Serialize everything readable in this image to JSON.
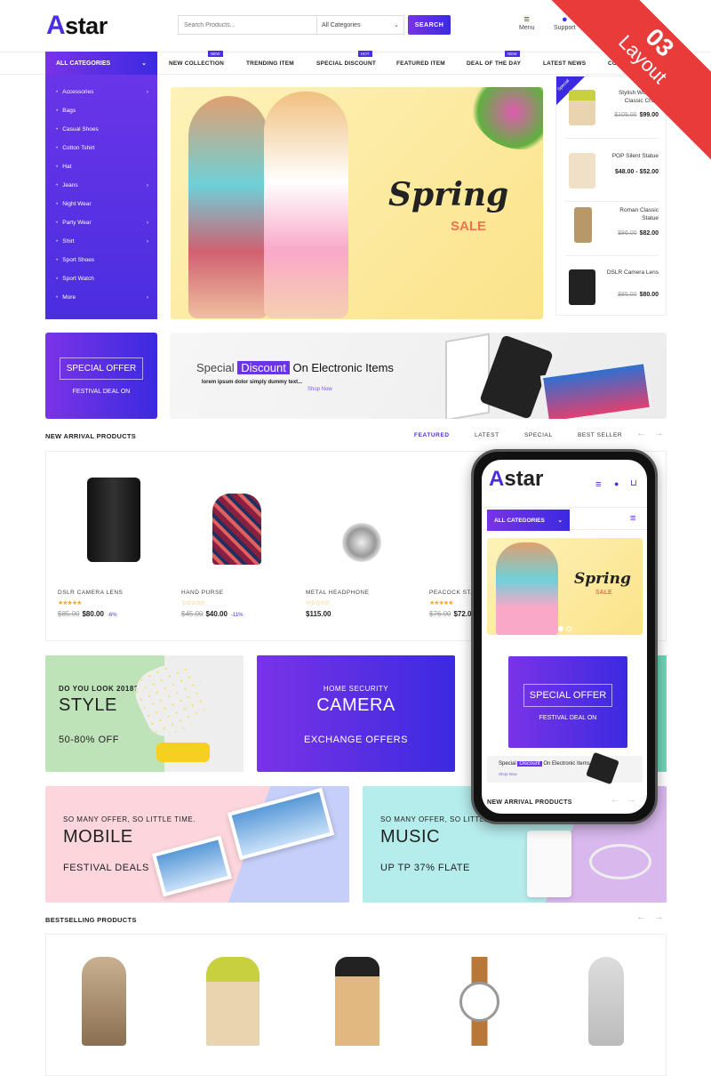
{
  "header": {
    "logo": "star",
    "logo_mark": "A",
    "search_placeholder": "Search Products...",
    "category_select": "All Categories",
    "search_button": "SEARCH",
    "menu_label": "Menu",
    "support_label": "Support"
  },
  "ribbon": {
    "number": "03",
    "label": "Layout"
  },
  "nav": {
    "all_categories": "ALL CATEGORIES",
    "items": [
      {
        "label": "NEW COLLECTION",
        "badge": "NEW"
      },
      {
        "label": "TRENDING ITEM"
      },
      {
        "label": "SPECIAL DISCOUNT",
        "badge": "HOT"
      },
      {
        "label": "FEATURED ITEM"
      },
      {
        "label": "DEAL OF THE DAY",
        "badge": "NEW"
      },
      {
        "label": "LATEST NEWS"
      },
      {
        "label": "CO"
      }
    ]
  },
  "sidebar": {
    "items": [
      {
        "label": "Accessories",
        "sub": true
      },
      {
        "label": "Bags"
      },
      {
        "label": "Casual Shoes"
      },
      {
        "label": "Cotton Tshirt"
      },
      {
        "label": "Hat"
      },
      {
        "label": "Jeans",
        "sub": true
      },
      {
        "label": "Night Wear"
      },
      {
        "label": "Party Wear",
        "sub": true
      },
      {
        "label": "Shirt",
        "sub": true
      },
      {
        "label": "Sport Shoes"
      },
      {
        "label": "Sport Watch"
      },
      {
        "label": "More",
        "sub": true
      }
    ]
  },
  "hero": {
    "title": "Spring",
    "subtitle": "SALE"
  },
  "special_products": {
    "tag": "Special",
    "items": [
      {
        "name": "Stylish Wooden Classic Chair",
        "old_price": "$105.00",
        "price": "$99.00"
      },
      {
        "name": "POP Silent Statue",
        "old_price": "",
        "price": "$48.00 - $52.00"
      },
      {
        "name": "Roman Classic Statue",
        "old_price": "$86.00",
        "price": "$82.00"
      },
      {
        "name": "DSLR Camera Lens",
        "old_price": "$85.00",
        "price": "$80.00"
      }
    ]
  },
  "offer": {
    "title": "SPECIAL OFFER",
    "subtitle": "FESTIVAL DEAL ON"
  },
  "discount_banner": {
    "word1": "Special",
    "highlight": "Discount",
    "rest": "On Electronic Items",
    "desc": "lorem ipsum dolor simply dummy text...",
    "link": "Shop Now"
  },
  "new_arrival": {
    "title": "NEW ARRIVAL PRODUCTS",
    "tabs": [
      "FEATURED",
      "LATEST",
      "SPECIAL",
      "BEST SELLER"
    ],
    "active_tab": "FEATURED",
    "products": [
      {
        "name": "DSLR CAMERA LENS",
        "rating": 5,
        "stars": "★★★★★",
        "old_price": "$85.00",
        "price": "$80.00",
        "discount": "-6%"
      },
      {
        "name": "HAND PURSE",
        "rating": 0,
        "stars": "☆☆☆☆☆",
        "old_price": "$45.00",
        "price": "$40.00",
        "discount": "-11%"
      },
      {
        "name": "METAL HEADPHONE",
        "rating": 0,
        "stars": "☆☆☆☆☆",
        "old_price": "",
        "price": "$115.00",
        "discount": ""
      },
      {
        "name": "PEACOCK STATUE",
        "rating": 5,
        "stars": "★★★★★",
        "old_price": "$76.00",
        "price": "$72.00",
        "discount": ""
      }
    ]
  },
  "banners": {
    "style": {
      "t1": "DO YOU LOOK 2018?",
      "t2": "STYLE",
      "t3": "50-80% OFF"
    },
    "camera": {
      "t1": "HOME SECURITY",
      "t2": "CAMERA",
      "t3": "EXCHANGE OFFERS"
    },
    "mobile": {
      "t1": "SO MANY OFFER, SO LITTLE TIME.",
      "t2": "MOBILE",
      "t3": "FESTIVAL DEALS"
    },
    "music": {
      "t1": "SO MANY OFFER, SO LITTLE TIME.",
      "t2": "MUSIC",
      "t3": "UP TP 37% FLATE"
    }
  },
  "bestselling": {
    "title": "BESTSELLING PRODUCTS"
  },
  "phone": {
    "logo": "star",
    "all_categories": "ALL CATEGORIES",
    "offer_title": "SPECIAL OFFER",
    "offer_sub": "FESTIVAL DEAL ON",
    "discount_word": "Special",
    "discount_highlight": "Discount",
    "discount_rest": "On Electronic Items",
    "shop_now": "Shop Now",
    "section_title": "NEW ARRIVAL PRODUCTS"
  },
  "colors": {
    "accent": "#4b2ee0",
    "accent2": "#7a33e6",
    "ribbon": "#ea3b3b",
    "star": "#f5a623"
  }
}
